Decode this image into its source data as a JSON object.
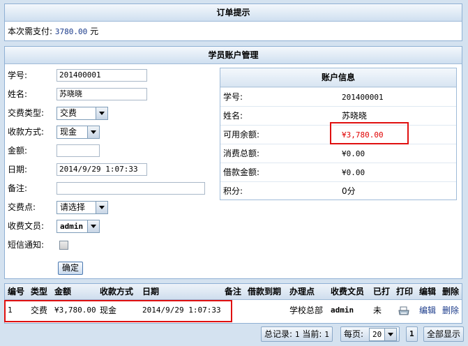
{
  "order_tip": {
    "title": "订单提示",
    "pay_label": "本次需支付:",
    "pay_amount": "3780.00",
    "pay_unit": "元"
  },
  "account_mgmt": {
    "title": "学员账户管理",
    "form": {
      "student_no_label": "学号:",
      "student_no_value": "201400001",
      "name_label": "姓名:",
      "name_value": "苏晓晓",
      "fee_type_label": "交费类型:",
      "fee_type_value": "交费",
      "pay_method_label": "收款方式:",
      "pay_method_value": "现金",
      "amount_label": "金额:",
      "amount_value": "",
      "date_label": "日期:",
      "date_value": "2014/9/29 1:07:33",
      "remark_label": "备注:",
      "remark_value": "",
      "pay_point_label": "交费点:",
      "pay_point_value": "请选择",
      "clerk_label": "收费文员:",
      "clerk_value": "admin",
      "sms_label": "短信通知:",
      "confirm_label": "确定"
    },
    "account_info": {
      "title": "账户信息",
      "rows": [
        {
          "key": "学号:",
          "value": "201400001"
        },
        {
          "key": "姓名:",
          "value": "苏晓晓"
        },
        {
          "key": "可用余额:",
          "value": "¥3,780.00"
        },
        {
          "key": "消费总额:",
          "value": "¥0.00"
        },
        {
          "key": "借款金额:",
          "value": "¥0.00"
        },
        {
          "key": "积分:",
          "value": "0分"
        }
      ],
      "balance_color": "#e00000"
    }
  },
  "records": {
    "headers": [
      "编号",
      "类型",
      "金额",
      "收款方式",
      "日期",
      "备注",
      "借款到期",
      "办理点",
      "收费文员",
      "已打",
      "打印",
      "编辑",
      "删除"
    ],
    "rows": [
      {
        "no": "1",
        "type": "交费",
        "amount": "¥3,780.00",
        "method": "现金",
        "date": "2014/9/29 1:07:33",
        "remark": "",
        "due": "",
        "office": "学校总部",
        "clerk": "admin",
        "printed": "未",
        "print_icon": "printer-icon",
        "edit": "编辑",
        "delete": "删除"
      }
    ]
  },
  "pager": {
    "total_label": "总记录:",
    "total_value": "1",
    "current_label": "当前:",
    "current_value": "1",
    "per_page_label": "每页:",
    "per_page_value": "20",
    "page_button": "1",
    "show_all": "全部显示"
  }
}
